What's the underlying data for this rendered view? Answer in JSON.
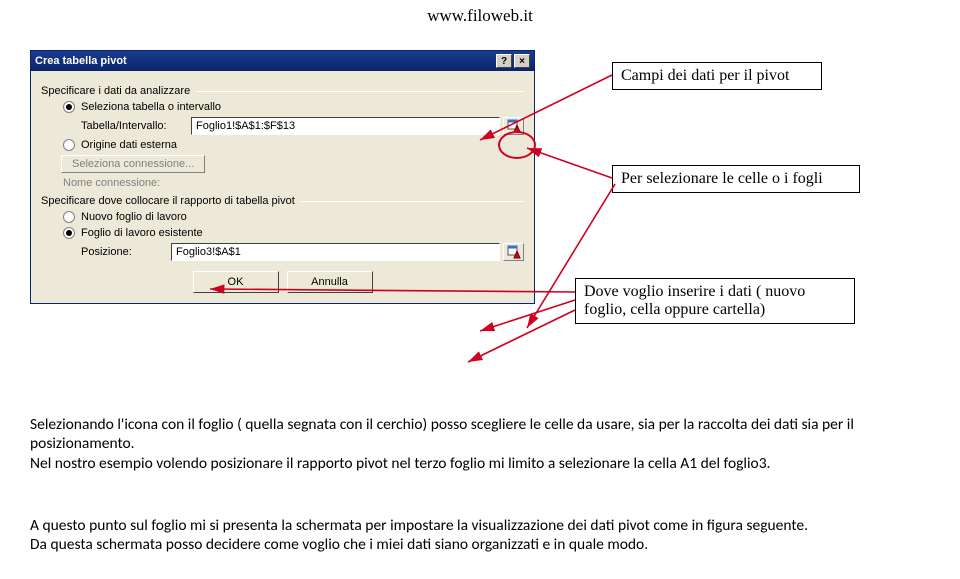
{
  "page": {
    "url": "www.filoweb.it"
  },
  "dialog": {
    "title": "Crea tabella pivot",
    "section_source": "Specificare i dati da analizzare",
    "opt_select_range": "Seleziona tabella o intervallo",
    "range_label": "Tabella/Intervallo:",
    "range_value": "Foglio1!$A$1:$F$13",
    "opt_external": "Origine dati esterna",
    "btn_select_conn": "Seleziona connessione...",
    "conn_name_label": "Nome connessione:",
    "section_dest": "Specificare dove collocare il rapporto di tabella pivot",
    "opt_new_sheet": "Nuovo foglio di lavoro",
    "opt_existing_sheet": "Foglio di lavoro esistente",
    "pos_label": "Posizione:",
    "pos_value": "Foglio3!$A$1",
    "ok": "OK",
    "cancel": "Annulla",
    "help_glyph": "?",
    "close_glyph": "×"
  },
  "callouts": {
    "fields": "Campi dei dati per il pivot",
    "selector": "Per selezionare le celle o i fogli",
    "dest": "Dove voglio inserire i dati ( nuovo foglio, cella oppure cartella)"
  },
  "body": {
    "p1": "Selezionando l'icona con il foglio ( quella segnata con il cerchio) posso scegliere le celle da usare, sia per la raccolta dei dati sia per il posizionamento.",
    "p2": "Nel nostro esempio volendo posizionare il rapporto pivot nel terzo foglio mi limito a selezionare la cella A1 del foglio3.",
    "p3": "A questo punto sul foglio mi si presenta la schermata per impostare la visualizzazione dei dati pivot come in figura seguente.",
    "p4": "Da questa schermata posso decidere come voglio che i miei dati siano organizzati e in quale modo."
  }
}
